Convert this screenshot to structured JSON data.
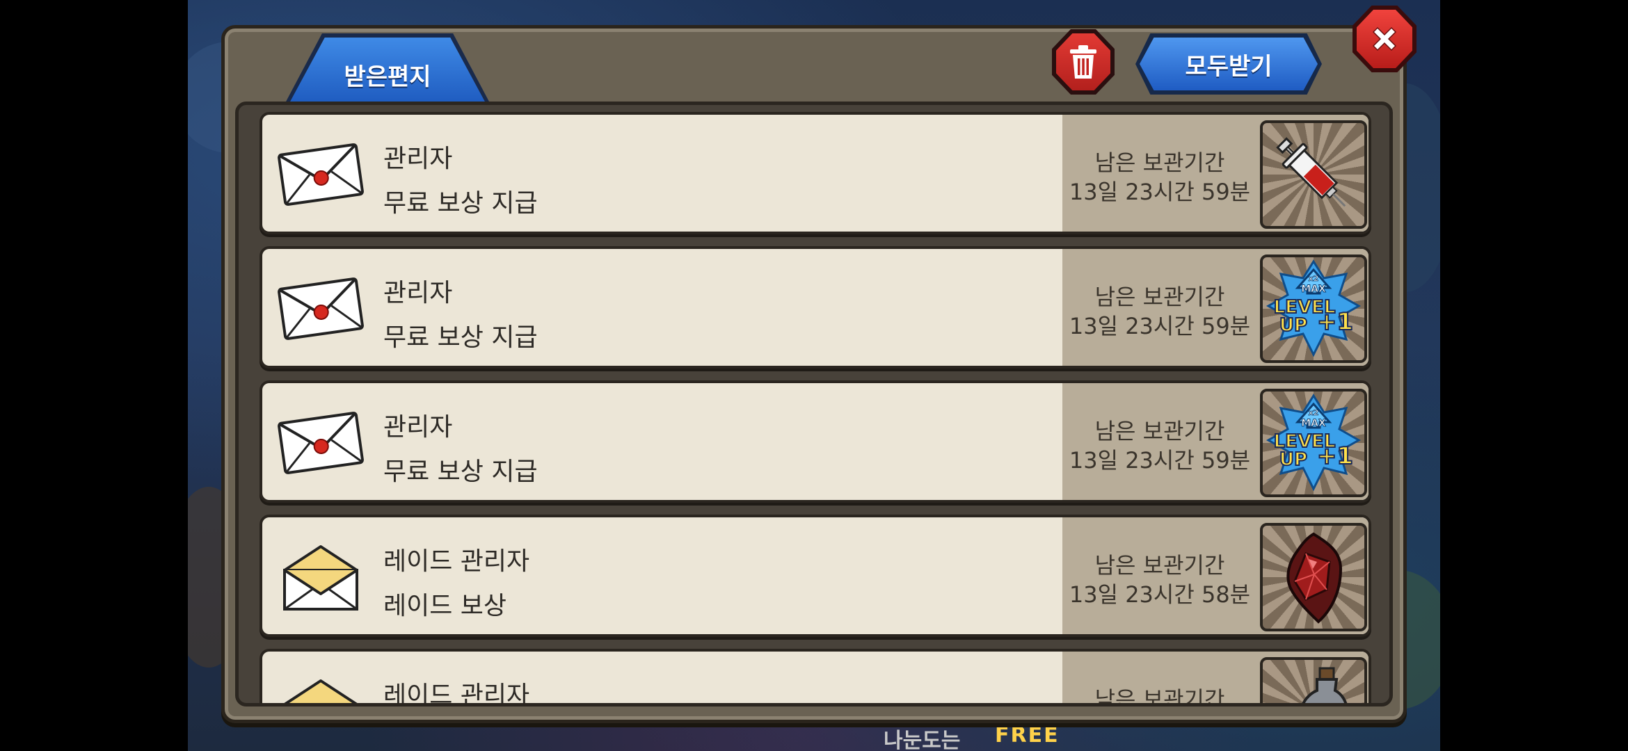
{
  "header": {
    "tab_label": "받은편지",
    "receive_all_label": "모두받기"
  },
  "background": {
    "free_text": "FREE",
    "left_text": "나눈도는"
  },
  "mails": [
    {
      "sender": "관리자",
      "subject": "무료 보상 지급",
      "time_label": "남은 보관기간",
      "time_value": "13일 23시간 59분",
      "envelope": "closed-red-seal",
      "reward_icon": "syringe-icon"
    },
    {
      "sender": "관리자",
      "subject": "무료 보상 지급",
      "time_label": "남은 보관기간",
      "time_value": "13일 23시간 59분",
      "envelope": "closed-red-seal",
      "reward_icon": "level-up-icon",
      "reward_text": {
        "x2": "x2",
        "max": "MAX",
        "level": "LEVEL",
        "up": "UP",
        "plus": "+1"
      }
    },
    {
      "sender": "관리자",
      "subject": "무료 보상 지급",
      "time_label": "남은 보관기간",
      "time_value": "13일 23시간 59분",
      "envelope": "closed-red-seal",
      "reward_icon": "level-up-icon",
      "reward_text": {
        "x2": "x2",
        "max": "MAX",
        "level": "LEVEL",
        "up": "UP",
        "plus": "+1"
      }
    },
    {
      "sender": "레이드 관리자",
      "subject": "레이드 보상",
      "time_label": "남은 보관기간",
      "time_value": "13일 23시간 58분",
      "envelope": "open-yellow",
      "reward_icon": "red-gem-icon"
    },
    {
      "sender": "레이드 관리자",
      "subject": "",
      "time_label": "남은 보관기간",
      "time_value": "",
      "envelope": "open-yellow",
      "reward_icon": "potion-icon"
    }
  ],
  "colors": {
    "panel": "#6a6253",
    "row": "#ece6d7",
    "time_box": "#b8ad99",
    "tab_blue": "#2f72d8",
    "close_red": "#d9302c"
  }
}
